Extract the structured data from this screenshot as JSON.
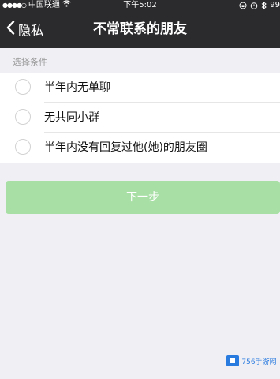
{
  "status_bar": {
    "signal_dots": "●●●●○",
    "carrier": "中国联通",
    "time": "下午5:02",
    "battery": "99"
  },
  "nav": {
    "back_label": "隐私",
    "title": "不常联系的朋友"
  },
  "section_header": "选择条件",
  "options": [
    {
      "label": "半年内无单聊"
    },
    {
      "label": "无共同小群"
    },
    {
      "label": "半年内没有回复过他(她)的朋友圈"
    }
  ],
  "next_button": "下一步",
  "watermark": "756手游网",
  "colors": {
    "nav_bg": "#2b2b2e",
    "page_bg": "#efeff4",
    "button_bg": "#a8dfa5",
    "watermark": "#2a7be0"
  },
  "icons": {
    "wifi": "wifi-icon",
    "lock": "orientation-lock-icon",
    "alarm": "alarm-icon",
    "bluetooth": "bluetooth-icon",
    "back": "chevron-left-icon"
  }
}
